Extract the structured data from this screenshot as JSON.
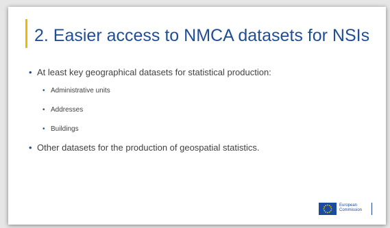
{
  "slide": {
    "title": "2. Easier access to NMCA datasets for NSIs",
    "bullets": {
      "b1": "At least key geographical datasets for statistical production:",
      "sub1": "Administrative units",
      "sub2": "Addresses",
      "sub3": "Buildings",
      "b2": "Other datasets for the production of geospatial statistics."
    },
    "bullet_glyph": "•",
    "logo": {
      "line1": "European",
      "line2": "Commission"
    }
  },
  "colors": {
    "title": "#1f4e96",
    "accent_bar": "#f2b500",
    "body_text": "#404040",
    "logo": "#1d4ba0"
  }
}
